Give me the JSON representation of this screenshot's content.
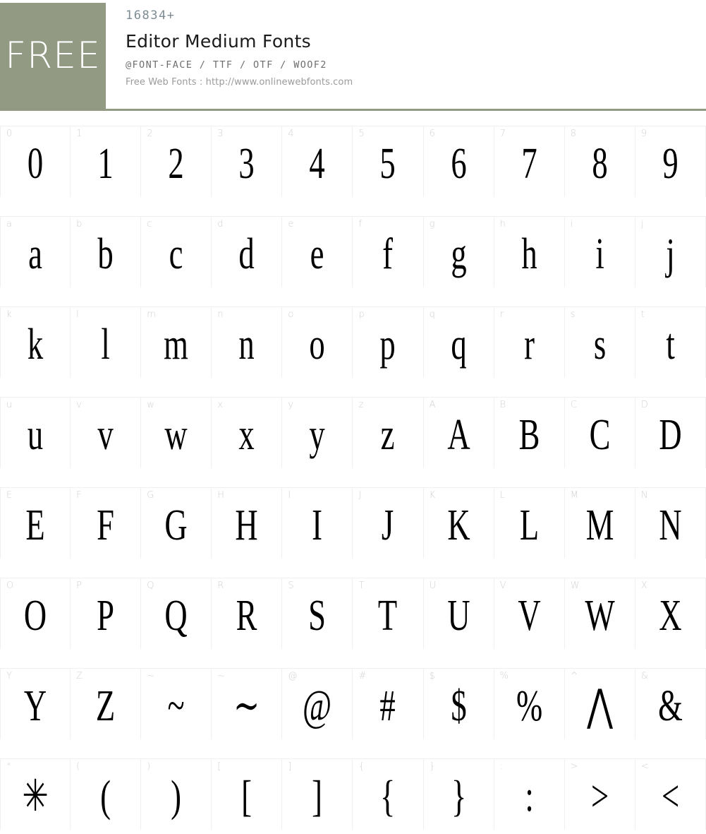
{
  "header": {
    "badge_label": "FREE",
    "font_count": "16834+",
    "title": "Editor Medium Fonts",
    "formats": "@FONT-FACE / TTF / OTF / WOOF2",
    "source": "Free Web Fonts : http://www.onlinewebfonts.com",
    "badge_color": "#929a83",
    "count_color": "#7d8c93",
    "title_color": "#1a1a1a"
  },
  "glyph_grid": {
    "columns": 10,
    "rows": [
      [
        {
          "label": "0",
          "char": "0"
        },
        {
          "label": "1",
          "char": "1"
        },
        {
          "label": "2",
          "char": "2"
        },
        {
          "label": "3",
          "char": "3"
        },
        {
          "label": "4",
          "char": "4"
        },
        {
          "label": "5",
          "char": "5"
        },
        {
          "label": "6",
          "char": "6"
        },
        {
          "label": "7",
          "char": "7"
        },
        {
          "label": "8",
          "char": "8"
        },
        {
          "label": "9",
          "char": "9"
        }
      ],
      [
        {
          "label": "a",
          "char": "a"
        },
        {
          "label": "b",
          "char": "b"
        },
        {
          "label": "c",
          "char": "c"
        },
        {
          "label": "d",
          "char": "d"
        },
        {
          "label": "e",
          "char": "e"
        },
        {
          "label": "f",
          "char": "f"
        },
        {
          "label": "g",
          "char": "g"
        },
        {
          "label": "h",
          "char": "h"
        },
        {
          "label": "i",
          "char": "i"
        },
        {
          "label": "j",
          "char": "j"
        }
      ],
      [
        {
          "label": "k",
          "char": "k"
        },
        {
          "label": "l",
          "char": "l"
        },
        {
          "label": "m",
          "char": "m"
        },
        {
          "label": "n",
          "char": "n"
        },
        {
          "label": "o",
          "char": "o"
        },
        {
          "label": "p",
          "char": "p"
        },
        {
          "label": "q",
          "char": "q"
        },
        {
          "label": "r",
          "char": "r"
        },
        {
          "label": "s",
          "char": "s"
        },
        {
          "label": "t",
          "char": "t"
        }
      ],
      [
        {
          "label": "u",
          "char": "u"
        },
        {
          "label": "v",
          "char": "v"
        },
        {
          "label": "w",
          "char": "w"
        },
        {
          "label": "x",
          "char": "x"
        },
        {
          "label": "y",
          "char": "y"
        },
        {
          "label": "z",
          "char": "z"
        },
        {
          "label": "A",
          "char": "A"
        },
        {
          "label": "B",
          "char": "B"
        },
        {
          "label": "C",
          "char": "C"
        },
        {
          "label": "D",
          "char": "D"
        }
      ],
      [
        {
          "label": "E",
          "char": "E"
        },
        {
          "label": "F",
          "char": "F"
        },
        {
          "label": "G",
          "char": "G"
        },
        {
          "label": "H",
          "char": "H"
        },
        {
          "label": "I",
          "char": "I"
        },
        {
          "label": "J",
          "char": "J"
        },
        {
          "label": "K",
          "char": "K"
        },
        {
          "label": "L",
          "char": "L"
        },
        {
          "label": "M",
          "char": "M"
        },
        {
          "label": "N",
          "char": "N"
        }
      ],
      [
        {
          "label": "O",
          "char": "O"
        },
        {
          "label": "P",
          "char": "P"
        },
        {
          "label": "Q",
          "char": "Q"
        },
        {
          "label": "R",
          "char": "R"
        },
        {
          "label": "S",
          "char": "S"
        },
        {
          "label": "T",
          "char": "T"
        },
        {
          "label": "U",
          "char": "U"
        },
        {
          "label": "V",
          "char": "V"
        },
        {
          "label": "W",
          "char": "W"
        },
        {
          "label": "X",
          "char": "X"
        }
      ],
      [
        {
          "label": "Y",
          "char": "Y"
        },
        {
          "label": "Z",
          "char": "Z"
        },
        {
          "label": "~",
          "char": "~"
        },
        {
          "label": "~",
          "char": "∼"
        },
        {
          "label": "@",
          "char": "@"
        },
        {
          "label": "#",
          "char": "#"
        },
        {
          "label": "$",
          "char": "$"
        },
        {
          "label": "%",
          "char": "%"
        },
        {
          "label": "^",
          "char": "⋀"
        },
        {
          "label": "&",
          "char": "&"
        }
      ],
      [
        {
          "label": "*",
          "char": "✳"
        },
        {
          "label": "(",
          "char": "("
        },
        {
          "label": ")",
          "char": ")"
        },
        {
          "label": "[",
          "char": "["
        },
        {
          "label": "]",
          "char": "]"
        },
        {
          "label": "{",
          "char": "{"
        },
        {
          "label": "}",
          "char": "}"
        },
        {
          "label": ":",
          "char": ":"
        },
        {
          "label": ">",
          "char": ">"
        },
        {
          "label": "<",
          "char": "<"
        }
      ]
    ]
  }
}
